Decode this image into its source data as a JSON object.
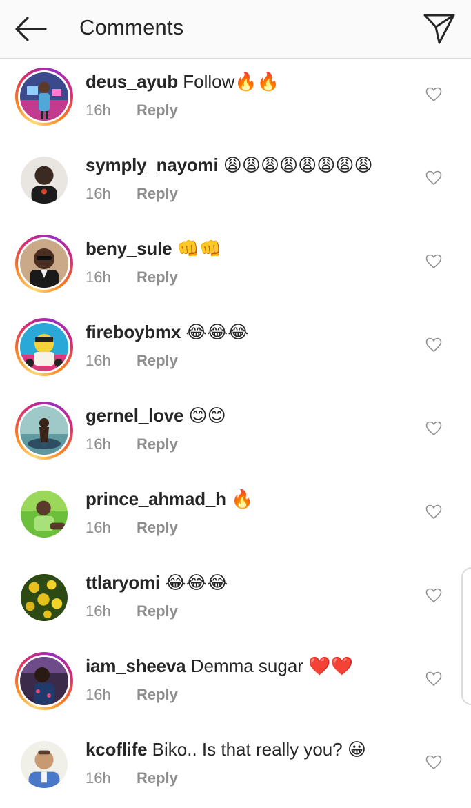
{
  "header": {
    "title": "Comments"
  },
  "colors": {
    "text": "#262626",
    "secondary": "#8e8e8e",
    "story_ring": [
      "#feda75",
      "#fa7e1e",
      "#d62976",
      "#962fbf"
    ]
  },
  "comments": [
    {
      "username": "deus_ayub",
      "text": "Follow🔥🔥",
      "time": "16h",
      "reply": "Reply",
      "story_ring": true,
      "avatar": "avatar-deus_ayub"
    },
    {
      "username": "symply_nayomi",
      "text": "😩😩😩😩😩😩😩😩",
      "time": "16h",
      "reply": "Reply",
      "story_ring": false,
      "avatar": "avatar-symply_nayomi"
    },
    {
      "username": "beny_sule",
      "text": "👊👊",
      "time": "16h",
      "reply": "Reply",
      "story_ring": true,
      "avatar": "avatar-beny_sule"
    },
    {
      "username": "fireboybmx",
      "text": "😂😂😂",
      "time": "16h",
      "reply": "Reply",
      "story_ring": true,
      "avatar": "avatar-fireboybmx"
    },
    {
      "username": "gernel_love",
      "text": "😊😊",
      "time": "16h",
      "reply": "Reply",
      "story_ring": true,
      "avatar": "avatar-gernel_love"
    },
    {
      "username": "prince_ahmad_h",
      "text": "🔥",
      "time": "16h",
      "reply": "Reply",
      "story_ring": false,
      "avatar": "avatar-prince_ahmad_h"
    },
    {
      "username": "ttlaryomi",
      "text": "😂😂😂",
      "time": "16h",
      "reply": "Reply",
      "story_ring": false,
      "avatar": "avatar-ttlaryomi"
    },
    {
      "username": "iam_sheeva",
      "text": "Demma sugar ❤️❤️",
      "time": "16h",
      "reply": "Reply",
      "story_ring": true,
      "avatar": "avatar-iam_sheeva"
    },
    {
      "username": "kcoflife",
      "text": "Biko.. Is that really you? 😀",
      "time": "16h",
      "reply": "Reply",
      "story_ring": false,
      "avatar": "avatar-kcoflife"
    }
  ]
}
